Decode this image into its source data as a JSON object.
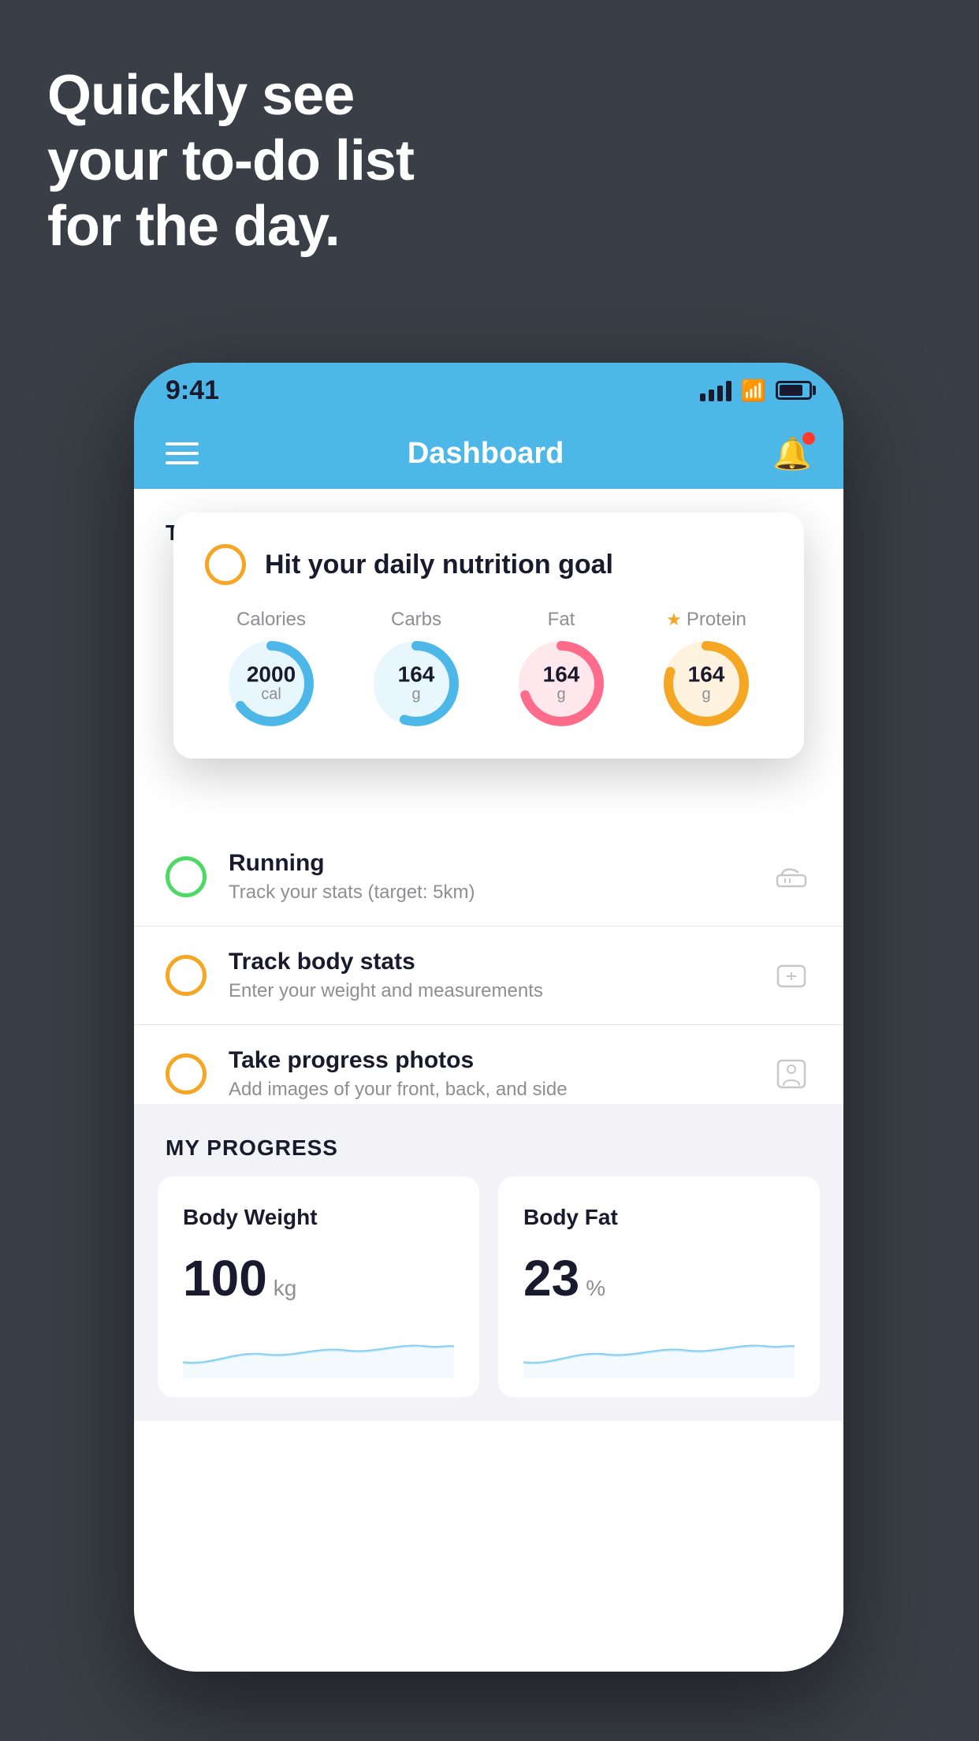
{
  "headline": {
    "line1": "Quickly see",
    "line2": "your to-do list",
    "line3": "for the day."
  },
  "status_bar": {
    "time": "9:41"
  },
  "nav": {
    "title": "Dashboard"
  },
  "things_to_do": {
    "section_label": "THINGS TO DO TODAY",
    "nutrition_card": {
      "title": "Hit your daily nutrition goal",
      "metrics": [
        {
          "label": "Calories",
          "value": "2000",
          "unit": "cal",
          "color": "#4db8e8",
          "bg": "#e8f6fd",
          "percent": 65
        },
        {
          "label": "Carbs",
          "value": "164",
          "unit": "g",
          "color": "#4db8e8",
          "bg": "#e8f6fd",
          "percent": 55
        },
        {
          "label": "Fat",
          "value": "164",
          "unit": "g",
          "color": "#ff6b8a",
          "bg": "#ffe8ed",
          "percent": 70
        },
        {
          "label": "Protein",
          "value": "164",
          "unit": "g",
          "color": "#f5a623",
          "bg": "#fff3e0",
          "percent": 80,
          "starred": true
        }
      ]
    },
    "items": [
      {
        "title": "Running",
        "subtitle": "Track your stats (target: 5km)",
        "circle_color": "green",
        "icon": "shoe"
      },
      {
        "title": "Track body stats",
        "subtitle": "Enter your weight and measurements",
        "circle_color": "yellow",
        "icon": "scale"
      },
      {
        "title": "Take progress photos",
        "subtitle": "Add images of your front, back, and side",
        "circle_color": "yellow",
        "icon": "person"
      }
    ]
  },
  "my_progress": {
    "section_label": "MY PROGRESS",
    "cards": [
      {
        "title": "Body Weight",
        "value": "100",
        "unit": "kg"
      },
      {
        "title": "Body Fat",
        "value": "23",
        "unit": "%"
      }
    ]
  }
}
